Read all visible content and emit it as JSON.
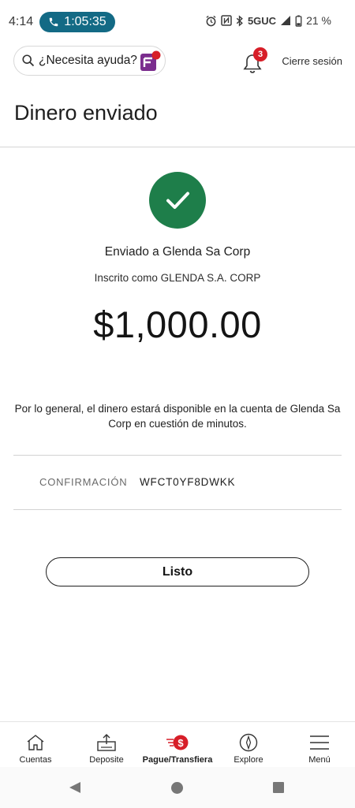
{
  "status_bar": {
    "time": "4:14",
    "call_timer": "1:05:35",
    "network": "5GUC",
    "battery": "21 %"
  },
  "header": {
    "help_placeholder": "¿Necesita ayuda?",
    "notifications_count": "3",
    "signout_label": "Cierre sesión"
  },
  "page": {
    "title": "Dinero enviado"
  },
  "confirmation": {
    "sent_to": "Enviado a Glenda Sa Corp",
    "registered_as": "Inscrito como GLENDA S.A. CORP",
    "amount": "$1,000.00",
    "availability_note": "Por lo general, el dinero estará disponible en la cuenta de Glenda Sa Corp en cuestión de minutos.",
    "code_label": "CONFIRMACIÓN",
    "code_value": "WFCT0YF8DWKK",
    "done_label": "Listo"
  },
  "bottom_nav": {
    "items": [
      {
        "label": "Cuentas",
        "icon": "home-icon"
      },
      {
        "label": "Deposite",
        "icon": "deposit-icon"
      },
      {
        "label": "Pague/Transfiera",
        "icon": "pay-transfer-icon"
      },
      {
        "label": "Explore",
        "icon": "compass-icon"
      },
      {
        "label": "Menú",
        "icon": "hamburger-menu-icon"
      }
    ],
    "active_index": 2
  },
  "colors": {
    "success_green": "#1e7e4a",
    "alert_red": "#d71e28",
    "call_pill": "#136a85"
  }
}
